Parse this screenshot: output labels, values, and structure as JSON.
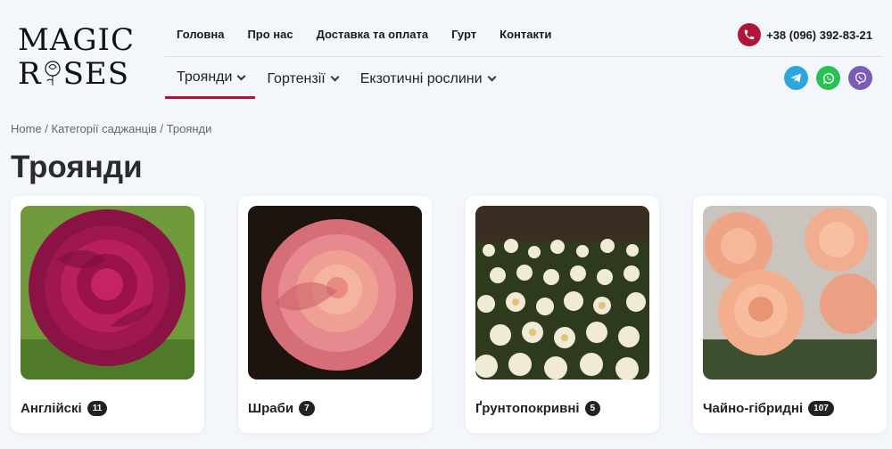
{
  "logo": {
    "line1": "MAGIC",
    "line2a": "R",
    "line2b": "SES"
  },
  "top_nav": [
    {
      "label": "Головна"
    },
    {
      "label": "Про нас"
    },
    {
      "label": "Доставка та оплата"
    },
    {
      "label": "Гурт"
    },
    {
      "label": "Контакти"
    }
  ],
  "phone": {
    "number": "+38 (096) 392-83-21",
    "icon": "phone-icon"
  },
  "category_nav": [
    {
      "label": "Троянди",
      "active": true
    },
    {
      "label": "Гортензії",
      "active": false
    },
    {
      "label": "Екзотичні рослини",
      "active": false
    }
  ],
  "socials": [
    {
      "icon": "telegram-icon",
      "color": "#2ea6dc"
    },
    {
      "icon": "whatsapp-icon",
      "color": "#2ac154"
    },
    {
      "icon": "viber-icon",
      "color": "#7d5bb8"
    }
  ],
  "breadcrumb": {
    "home": "Home",
    "sep1": " / ",
    "category": "Категорії саджанців",
    "sep2": " / ",
    "current": "Троянди"
  },
  "page_title": "Троянди",
  "cards": [
    {
      "name": "Англійскі",
      "count": "11",
      "image": "magenta-english-rose"
    },
    {
      "name": "Шраби",
      "count": "7",
      "image": "pink-shrub-rose"
    },
    {
      "name": "Ґрунтопокривні",
      "count": "5",
      "image": "white-groundcover-roses"
    },
    {
      "name": "Чайно-гібридні",
      "count": "107",
      "image": "peach-hybrid-tea-roses"
    }
  ],
  "colors": {
    "accent": "#b0143a",
    "background": "#f3f6fa"
  }
}
